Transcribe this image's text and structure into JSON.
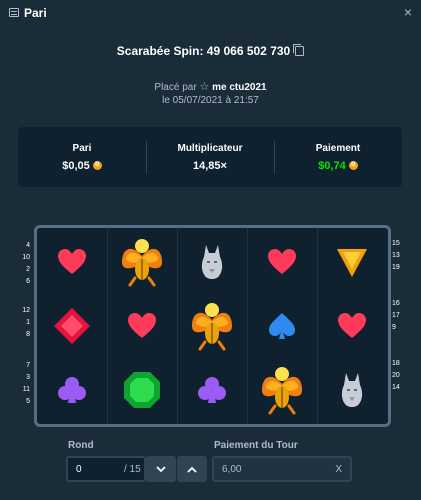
{
  "window": {
    "title": "Pari",
    "close_label": "×"
  },
  "spin": {
    "title": "Scarabée Spin: 49 066 502 730"
  },
  "placed": {
    "prefix": "Placé par",
    "user": "me ctu2021",
    "date": "le 05/07/2021 à 21:57"
  },
  "stats": {
    "bet": {
      "label": "Pari",
      "value": "$0,05"
    },
    "multiplier": {
      "label": "Multiplicateur",
      "value": "14,85×"
    },
    "payout": {
      "label": "Paiement",
      "value": "$0,74"
    }
  },
  "reels": {
    "left_numbers": [
      [
        "4",
        "10",
        "2",
        "6"
      ],
      [
        "12",
        "1",
        "8"
      ],
      [
        "7",
        "3",
        "11",
        "5"
      ]
    ],
    "right_numbers": [
      [
        "15",
        "13",
        "19"
      ],
      [
        "16",
        "17",
        "9"
      ],
      [
        "18",
        "20",
        "14"
      ]
    ],
    "grid": [
      [
        "heart-red",
        "scarab-gold",
        "wolf-grey",
        "heart-red",
        "triangle-orange"
      ],
      [
        "diamond-red",
        "heart-red",
        "scarab-gold",
        "spade-blue",
        "heart-red"
      ],
      [
        "club-purple",
        "gem-green",
        "club-purple",
        "scarab-gold",
        "wolf-grey"
      ]
    ]
  },
  "controls": {
    "round": {
      "label": "Rond",
      "value": "0",
      "total": "/ 15"
    },
    "round_payout": {
      "label": "Paiement du Tour",
      "value": "6,00",
      "suffix": "X"
    }
  },
  "colors": {
    "background": "#1a2c38",
    "panel": "#0f212e",
    "green": "#00e701",
    "coin": "#f7a21b"
  }
}
